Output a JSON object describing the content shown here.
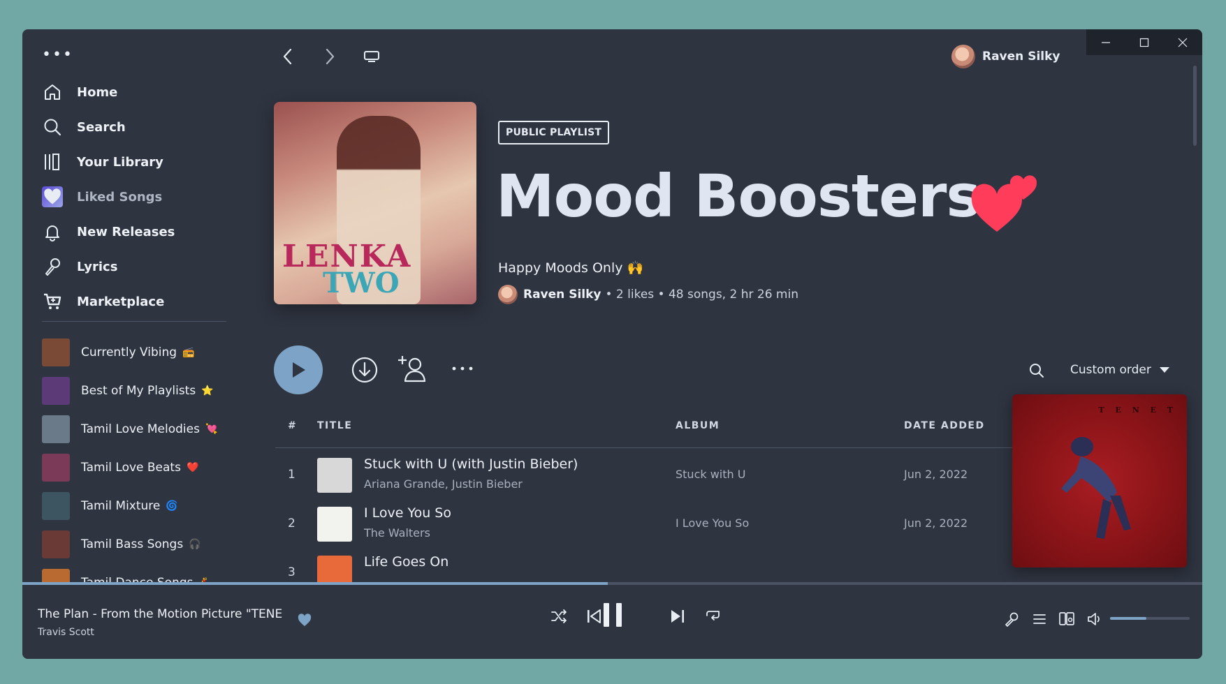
{
  "window": {
    "controls": [
      "minimize-icon",
      "maximize-icon",
      "close-icon"
    ]
  },
  "topbar": {
    "user_name": "Raven Silky"
  },
  "sidebar": {
    "menu_dots": "•••",
    "nav": [
      {
        "label": "Home",
        "icon": "home-icon"
      },
      {
        "label": "Search",
        "icon": "search-icon"
      },
      {
        "label": "Your Library",
        "icon": "library-icon"
      },
      {
        "label": "Liked Songs",
        "icon": "heart-icon"
      },
      {
        "label": "New Releases",
        "icon": "bell-icon"
      },
      {
        "label": "Lyrics",
        "icon": "microphone-icon"
      },
      {
        "label": "Marketplace",
        "icon": "cart-icon"
      }
    ],
    "playlists": [
      {
        "name": "Currently Vibing",
        "emoji": "📻",
        "thumb": "#7a4a36"
      },
      {
        "name": "Best of My Playlists",
        "emoji": "⭐",
        "thumb": "#5c3a78"
      },
      {
        "name": "Tamil Love Melodies",
        "emoji": "💘",
        "thumb": "#6b7a88"
      },
      {
        "name": "Tamil Love Beats",
        "emoji": "❤️",
        "thumb": "#7b3a58"
      },
      {
        "name": "Tamil Mixture",
        "emoji": "🌀",
        "thumb": "#3d5560"
      },
      {
        "name": "Tamil Bass Songs",
        "emoji": "🎧",
        "thumb": "#6a3a36"
      },
      {
        "name": "Tamil Dance Songs",
        "emoji": "💃",
        "thumb": "#b86a30"
      }
    ]
  },
  "playlist": {
    "badge": "PUBLIC PLAYLIST",
    "title": "Mood Boosters",
    "description": "Happy Moods Only 🙌",
    "owner": "Raven Silky",
    "stats": "• 2 likes • 48 songs, 2 hr 26 min",
    "cover_text_1": "LENKA",
    "cover_text_2": "TWO"
  },
  "actions": {
    "sort_label": "Custom order"
  },
  "table": {
    "headers": {
      "num": "#",
      "title": "TITLE",
      "album": "ALBUM",
      "date": "DATE ADDED"
    },
    "tracks": [
      {
        "num": "1",
        "title": "Stuck with U (with Justin Bieber)",
        "artist": "Ariana Grande, Justin Bieber",
        "album": "Stuck with U",
        "date": "Jun 2, 2022",
        "art": "#d8d8d8"
      },
      {
        "num": "2",
        "title": "I Love You So",
        "artist": "The Walters",
        "album": "I Love You So",
        "date": "Jun 2, 2022",
        "art": "#f2f2ee"
      },
      {
        "num": "3",
        "title": "Life Goes On",
        "artist": "",
        "album": "",
        "date": "",
        "art": "#e86a3a"
      }
    ]
  },
  "now_playing": {
    "title": "The Plan - From the Motion Picture \"TENET\"",
    "artist": "Travis Scott",
    "art_title": "T E N E T",
    "progress": 0.496,
    "volume": 0.46
  },
  "colors": {
    "accent": "#7da4c6",
    "heart": "#ff3d5a",
    "background": "#2e3440"
  }
}
